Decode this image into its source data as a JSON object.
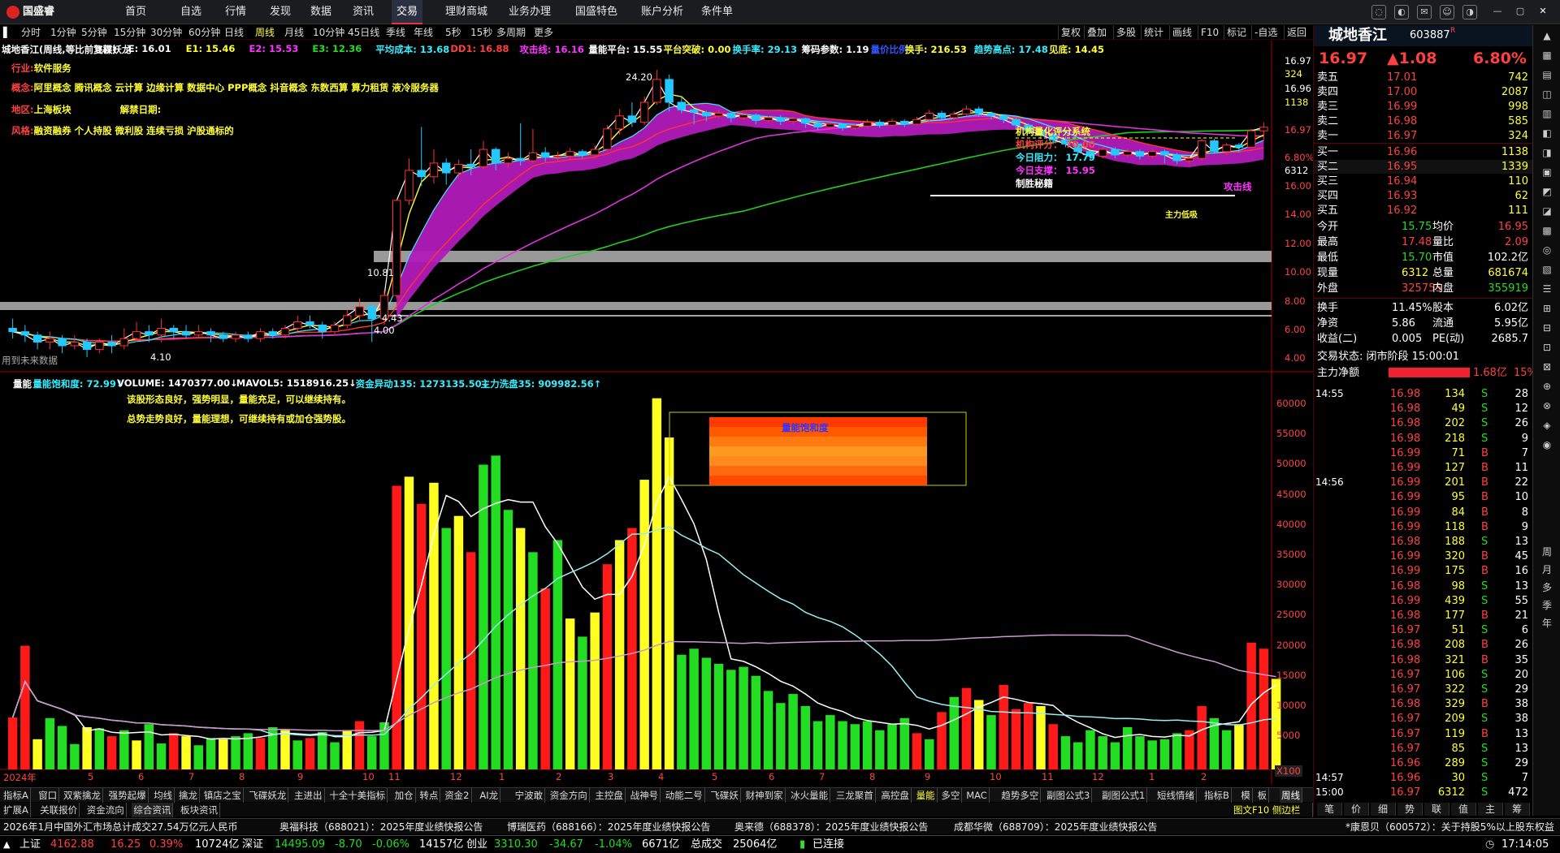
{
  "menu": {
    "brand": "国盛睿",
    "items": [
      "首页",
      "自选",
      "行情",
      "发现",
      "数据",
      "资讯",
      "交易",
      "理财商城",
      "业务办理",
      "国盛特色",
      "账户分析",
      "条件单"
    ],
    "active": "交易"
  },
  "periods": {
    "items": [
      "分时",
      "1分钟",
      "5分钟",
      "15分钟",
      "30分钟",
      "60分钟",
      "日线",
      "周线",
      "月线",
      "10分钟",
      "45日线",
      "季线",
      "年线",
      "5秒",
      "15秒",
      "多周期",
      "更多"
    ],
    "active": "周线"
  },
  "rightbtns": [
    "复权",
    "叠加",
    "多股",
    "统计",
    "画线",
    "F10",
    "标记",
    "-自选",
    "返回"
  ],
  "ma_line": [
    {
      "t": "城地香江(周线,等比前复权)",
      "c": "#ffffff"
    },
    {
      "t": "飞碟妖龙",
      "c": "#ffffff"
    },
    {
      "t": "E: 16.01",
      "c": "#ffffff"
    },
    {
      "t": "E1: 15.46",
      "c": "#ffff33"
    },
    {
      "t": "E2: 15.53",
      "c": "#ff33ff"
    },
    {
      "t": "E3: 12.36",
      "c": "#22dd22"
    },
    {
      "t": "平均成本: 13.68",
      "c": "#33eeff"
    },
    {
      "t": "DD1: 16.88",
      "c": "#ff4040"
    },
    {
      "t": "攻击线: 16.16",
      "c": "#ff33ff"
    },
    {
      "t": "量能平台: 15.55",
      "c": "#ffffff"
    },
    {
      "t": "平台突破: 0.00",
      "c": "#ffff33"
    },
    {
      "t": "换手率: 29.13",
      "c": "#33eeff"
    },
    {
      "t": "筹码参数: 1.19",
      "c": "#ffffff"
    },
    {
      "t": "量价比例",
      "c": "#3355ff"
    },
    {
      "t": "换手: 216.53",
      "c": "#ffff33"
    },
    {
      "t": "趋势高点: 17.48",
      "c": "#33eeff"
    },
    {
      "t": "见底: 14.45",
      "c": "#ffff33"
    }
  ],
  "info": {
    "industry_label": "行业:",
    "industry": "软件服务",
    "concept_label": "概念:",
    "concept": "阿里概念 腾讯概念 云计算 边缘计算 数据中心 PPP概念 抖音概念 东数西算 算力租赁 液冷服务器",
    "region_label": "地区:",
    "region": "上海板块",
    "unban_label": "解禁日期:",
    "style_label": "风格:",
    "style": "融资融券 个人持股 微利股 连续亏损 沪股通标的"
  },
  "annotations": {
    "high_price": "24.20",
    "low_price": "4.10",
    "mid1": "10.81",
    "mid2": "4.43",
    "mid3": "4.00",
    "attack_line": "攻击线",
    "main_force": "主力低吸",
    "scoring": {
      "title": "机构量化评分系统",
      "score": "机构评分： 70.00",
      "resist": "今日阻力： 17.79",
      "support": "今日支撑： 15.95",
      "tag": "制胜秘籍"
    },
    "future_data": "用到未来数据",
    "dragon": "龙",
    "buy": "B",
    "sell": "S"
  },
  "price_axis": [
    "16.97",
    "324",
    "16.96",
    "1138",
    "16.97",
    "6.80%",
    "6312",
    "16.00",
    "14.00",
    "12.00",
    "10.00",
    "8.00",
    "6.00",
    "4.00"
  ],
  "vol_header": [
    {
      "t": "量能",
      "c": "#ffffff"
    },
    {
      "t": "量能饱和度: 72.99↓",
      "c": "#33eeff"
    },
    {
      "t": "VOLUME: 1470377.00↓",
      "c": "#ffffff"
    },
    {
      "t": "MAVOL5: 1518916.25↓",
      "c": "#ffffff"
    },
    {
      "t": "资金异动135: 1273135.50↓",
      "c": "#33eeff"
    },
    {
      "t": "主力洗盘35: 909982.56↑",
      "c": "#33eeff"
    }
  ],
  "vol_comment1": "该股形态良好，强势明显，量能充足，可以继续持有。",
  "vol_comment2": "总势走势良好，量能理想，可继续持有或加仓强势股。",
  "saturation_title": "量能饱和度",
  "vol_axis": [
    "60000",
    "55000",
    "50000",
    "45000",
    "40000",
    "35000",
    "30000",
    "25000",
    "20000",
    "15000",
    "10000",
    "5000"
  ],
  "vol_unit": "X100",
  "x_axis": [
    "2024年",
    "5",
    "6",
    "7",
    "8",
    "9",
    "10",
    "11",
    "12",
    "1",
    "2",
    "3",
    "4",
    "5",
    "6",
    "7",
    "8",
    "9",
    "10",
    "11",
    "12",
    "1",
    "2"
  ],
  "chart_data": {
    "type": "candlestick",
    "title": "城地香江(周线,等比前复权)",
    "ylim": [
      4.0,
      24.2
    ],
    "weeks": [
      [
        4.9,
        4.8,
        5.2,
        4.6
      ],
      [
        4.8,
        4.7,
        5.0,
        4.5
      ],
      [
        4.7,
        4.5,
        4.8,
        4.3
      ],
      [
        4.5,
        4.6,
        4.8,
        4.3
      ],
      [
        4.6,
        4.4,
        4.7,
        4.2
      ],
      [
        4.4,
        4.5,
        4.7,
        4.3
      ],
      [
        4.5,
        4.3,
        4.6,
        4.1
      ],
      [
        4.3,
        4.5,
        4.6,
        4.2
      ],
      [
        4.5,
        4.4,
        4.7,
        4.2
      ],
      [
        4.4,
        4.6,
        4.9,
        4.3
      ],
      [
        4.6,
        4.8,
        5.1,
        4.5
      ],
      [
        4.8,
        4.7,
        5.0,
        4.5
      ],
      [
        4.7,
        4.9,
        5.2,
        4.5
      ],
      [
        4.9,
        4.8,
        5.0,
        4.6
      ],
      [
        4.8,
        4.7,
        5.0,
        4.6
      ],
      [
        4.7,
        4.8,
        5.0,
        4.6
      ],
      [
        4.8,
        4.7,
        4.9,
        4.5
      ],
      [
        4.7,
        4.6,
        4.8,
        4.5
      ],
      [
        4.6,
        4.7,
        4.8,
        4.5
      ],
      [
        4.7,
        4.6,
        4.8,
        4.5
      ],
      [
        4.6,
        4.8,
        4.9,
        4.5
      ],
      [
        4.8,
        4.7,
        4.9,
        4.6
      ],
      [
        4.7,
        4.9,
        5.0,
        4.6
      ],
      [
        4.9,
        5.1,
        5.3,
        4.8
      ],
      [
        5.1,
        5.0,
        5.3,
        4.9
      ],
      [
        5.0,
        4.8,
        5.1,
        4.6
      ],
      [
        4.8,
        5.0,
        5.1,
        4.7
      ],
      [
        5.0,
        5.3,
        5.5,
        4.9
      ],
      [
        5.3,
        5.6,
        5.9,
        5.1
      ],
      [
        5.6,
        5.2,
        5.7,
        4.5
      ],
      [
        5.2,
        6.0,
        6.2,
        5.0
      ],
      [
        6.0,
        10.8,
        10.9,
        5.9
      ],
      [
        10.8,
        13.0,
        14.0,
        10.5
      ],
      [
        13.0,
        12.5,
        17.0,
        11.8
      ],
      [
        12.5,
        13.6,
        14.8,
        12.0
      ],
      [
        13.6,
        12.8,
        14.0,
        11.9
      ],
      [
        12.8,
        13.5,
        13.9,
        12.4
      ],
      [
        13.5,
        13.3,
        14.8,
        12.6
      ],
      [
        13.3,
        14.8,
        15.6,
        13.1
      ],
      [
        14.8,
        13.6,
        15.0,
        13.0
      ],
      [
        13.6,
        14.0,
        14.5,
        13.2
      ],
      [
        14.0,
        13.8,
        17.4,
        13.4
      ],
      [
        13.8,
        14.5,
        16.8,
        13.6
      ],
      [
        14.5,
        14.1,
        15.0,
        13.7
      ],
      [
        14.1,
        14.2,
        14.6,
        13.8
      ],
      [
        14.2,
        14.6,
        14.9,
        13.9
      ],
      [
        14.6,
        14.3,
        14.8,
        14.0
      ],
      [
        14.3,
        14.8,
        15.2,
        14.0
      ],
      [
        14.8,
        16.8,
        17.2,
        14.6
      ],
      [
        16.8,
        18.2,
        19.0,
        16.2
      ],
      [
        18.2,
        17.5,
        19.8,
        17.0
      ],
      [
        17.5,
        19.8,
        20.5,
        17.2
      ],
      [
        19.8,
        22.8,
        24.2,
        19.5
      ],
      [
        22.8,
        19.8,
        23.5,
        18.7
      ],
      [
        19.8,
        18.9,
        20.5,
        18.5
      ],
      [
        18.9,
        18.6,
        19.0,
        17.3
      ],
      [
        18.6,
        18.2,
        18.8,
        17.6
      ],
      [
        18.2,
        18.5,
        18.9,
        17.9
      ],
      [
        18.5,
        18.0,
        18.7,
        17.5
      ],
      [
        18.0,
        18.3,
        18.6,
        17.7
      ],
      [
        18.3,
        17.7,
        18.5,
        17.3
      ],
      [
        17.7,
        18.0,
        18.2,
        17.4
      ],
      [
        18.0,
        17.6,
        18.3,
        17.2
      ],
      [
        17.6,
        17.9,
        18.1,
        17.3
      ],
      [
        17.9,
        17.4,
        18.0,
        16.9
      ],
      [
        17.4,
        17.0,
        17.6,
        16.7
      ],
      [
        17.0,
        17.3,
        17.5,
        16.8
      ],
      [
        17.3,
        16.9,
        17.4,
        16.6
      ],
      [
        16.9,
        17.1,
        17.3,
        16.7
      ],
      [
        17.1,
        17.5,
        17.8,
        16.9
      ],
      [
        17.5,
        17.2,
        17.8,
        16.9
      ],
      [
        17.2,
        17.6,
        17.9,
        17.0
      ],
      [
        17.6,
        17.3,
        17.8,
        17.0
      ],
      [
        17.3,
        17.8,
        18.1,
        17.1
      ],
      [
        17.8,
        18.5,
        18.9,
        17.5
      ],
      [
        18.5,
        18.0,
        18.8,
        17.7
      ],
      [
        18.0,
        18.4,
        18.7,
        17.8
      ],
      [
        18.4,
        19.0,
        19.4,
        18.2
      ],
      [
        19.0,
        18.5,
        19.3,
        18.1
      ],
      [
        18.5,
        18.2,
        18.7,
        17.8
      ],
      [
        18.2,
        17.8,
        18.4,
        17.4
      ],
      [
        17.8,
        17.2,
        18.0,
        16.8
      ],
      [
        17.2,
        16.6,
        17.4,
        16.3
      ],
      [
        16.6,
        16.2,
        16.8,
        15.8
      ],
      [
        16.2,
        15.7,
        16.4,
        15.3
      ],
      [
        15.7,
        15.3,
        16.0,
        15.0
      ],
      [
        15.3,
        14.6,
        15.5,
        14.3
      ],
      [
        14.6,
        14.2,
        14.8,
        13.9
      ],
      [
        14.2,
        14.8,
        15.0,
        14.0
      ],
      [
        14.8,
        14.3,
        15.0,
        14.0
      ],
      [
        14.3,
        14.6,
        14.9,
        14.1
      ],
      [
        14.6,
        14.2,
        14.8,
        13.9
      ],
      [
        14.2,
        14.6,
        14.9,
        14.0
      ],
      [
        14.6,
        14.3,
        14.8,
        13.6
      ],
      [
        14.3,
        13.8,
        14.5,
        13.5
      ],
      [
        13.8,
        14.0,
        14.2,
        13.5
      ],
      [
        14.0,
        15.6,
        15.8,
        13.8
      ],
      [
        15.6,
        14.6,
        15.8,
        14.4
      ],
      [
        14.6,
        15.2,
        15.4,
        14.3
      ],
      [
        15.2,
        15.0,
        15.4,
        14.5
      ],
      [
        15.0,
        16.6,
        16.8,
        14.9
      ],
      [
        16.6,
        16.97,
        17.48,
        15.7
      ]
    ],
    "volume_hundreds": [
      8600,
      20500,
      5000,
      8500,
      7200,
      4200,
      7000,
      6800,
      5500,
      6500,
      4800,
      7500,
      4300,
      6000,
      5500,
      4000,
      5200,
      5000,
      5500,
      6000,
      5200,
      7000,
      6500,
      4800,
      5200,
      6200,
      4500,
      6500,
      8000,
      5500,
      7800,
      47000,
      48500,
      44000,
      47500,
      40000,
      42000,
      36000,
      50500,
      52000,
      43000,
      40000,
      36000,
      30000,
      38000,
      25000,
      22000,
      26000,
      34000,
      38000,
      40000,
      48000,
      61500,
      55000,
      19000,
      20000,
      18500,
      17500,
      16500,
      17000,
      15500,
      13000,
      11000,
      12500,
      10500,
      8000,
      9000,
      8000,
      7500,
      8000,
      6500,
      7500,
      8500,
      6000,
      5000,
      9500,
      12000,
      13500,
      11500,
      9000,
      14000,
      10000,
      11000,
      10500,
      7500,
      5500,
      4500,
      6500,
      5500,
      4500,
      7000,
      5500,
      4800,
      5000,
      6000,
      6500,
      10500,
      8500,
      6500,
      7500,
      21000,
      20000,
      15000
    ],
    "volume_colors": [
      "r",
      "r",
      "y",
      "g",
      "g",
      "g",
      "y",
      "g",
      "r",
      "g",
      "y",
      "g",
      "g",
      "r",
      "y",
      "g",
      "g",
      "y",
      "g",
      "g",
      "r",
      "g",
      "y",
      "g",
      "r",
      "g",
      "g",
      "y",
      "r",
      "g",
      "g",
      "r",
      "y",
      "r",
      "y",
      "g",
      "y",
      "r",
      "g",
      "g",
      "g",
      "y",
      "g",
      "r",
      "g",
      "y",
      "g",
      "y",
      "r",
      "y",
      "r",
      "y",
      "y",
      "y",
      "g",
      "g",
      "g",
      "g",
      "g",
      "g",
      "g",
      "g",
      "g",
      "g",
      "g",
      "g",
      "g",
      "g",
      "g",
      "g",
      "g",
      "g",
      "g",
      "r",
      "g",
      "r",
      "g",
      "r",
      "y",
      "g",
      "r",
      "r",
      "r",
      "y",
      "r",
      "g",
      "g",
      "g",
      "g",
      "g",
      "g",
      "g",
      "g",
      "g",
      "g",
      "r",
      "r",
      "g",
      "g",
      "y",
      "r",
      "r",
      "y"
    ]
  },
  "quote": {
    "name": "城地香江",
    "code": "603887",
    "rflag": "R",
    "price": "16.97",
    "change": "▲1.08",
    "pct": "6.80%",
    "asks": [
      {
        "l": "卖五",
        "p": "17.01",
        "v": "742"
      },
      {
        "l": "卖四",
        "p": "17.00",
        "v": "2087"
      },
      {
        "l": "卖三",
        "p": "16.99",
        "v": "998"
      },
      {
        "l": "卖二",
        "p": "16.98",
        "v": "585"
      },
      {
        "l": "卖一",
        "p": "16.97",
        "v": "324"
      }
    ],
    "bids": [
      {
        "l": "买一",
        "p": "16.96",
        "v": "1138"
      },
      {
        "l": "买二",
        "p": "16.95",
        "v": "1339"
      },
      {
        "l": "买三",
        "p": "16.94",
        "v": "110"
      },
      {
        "l": "买四",
        "p": "16.93",
        "v": "62"
      },
      {
        "l": "买五",
        "p": "16.92",
        "v": "111"
      }
    ],
    "stats": [
      {
        "a": "今开",
        "av": "15.75",
        "ac": "#22dd22",
        "b": "均价",
        "bv": "16.95",
        "bc": "#ff4040"
      },
      {
        "a": "最高",
        "av": "17.48",
        "ac": "#ff4040",
        "b": "量比",
        "bv": "2.09",
        "bc": "#ff4040"
      },
      {
        "a": "最低",
        "av": "15.70",
        "ac": "#22dd22",
        "b": "市值",
        "bv": "102.2亿",
        "bc": "#ffffff"
      },
      {
        "a": "现量",
        "av": "6312",
        "ac": "#ffff33",
        "b": "总量",
        "bv": "681674",
        "bc": "#ffff33"
      },
      {
        "a": "外盘",
        "av": "325755",
        "ac": "#ff4040",
        "b": "内盘",
        "bv": "355919",
        "bc": "#22dd22"
      }
    ],
    "stats2": [
      {
        "a": "换手",
        "av": "11.45%",
        "b": "股本",
        "bv": "6.02亿"
      },
      {
        "a": "净资",
        "av": "5.86",
        "b": "流通",
        "bv": "5.95亿"
      },
      {
        "a": "收益(二)",
        "av": "0.005",
        "b": "PE(动)",
        "bv": "2685.7"
      }
    ],
    "trade_status": "交易状态: 闭市阶段 15:00:01",
    "net_label": "主力净额",
    "net_value": "1.68亿",
    "net_pct": "15%",
    "ticks_time1": "14:55",
    "ticks_time2": "14:56",
    "ticks_time3": "14:57",
    "ticks_time4": "15:00",
    "ticks": [
      [
        "16.98",
        "134",
        "S",
        "28"
      ],
      [
        "16.98",
        "49",
        "S",
        "12"
      ],
      [
        "16.98",
        "202",
        "S",
        "26"
      ],
      [
        "16.98",
        "218",
        "S",
        "9"
      ],
      [
        "16.99",
        "71",
        "B",
        "7"
      ],
      [
        "16.99",
        "127",
        "B",
        "11"
      ],
      [
        "16.99",
        "201",
        "B",
        "22"
      ],
      [
        "16.99",
        "95",
        "B",
        "10"
      ],
      [
        "16.99",
        "84",
        "B",
        "8"
      ],
      [
        "16.99",
        "118",
        "B",
        "9"
      ],
      [
        "16.98",
        "188",
        "S",
        "13"
      ],
      [
        "16.99",
        "320",
        "B",
        "45"
      ],
      [
        "16.99",
        "175",
        "B",
        "16"
      ],
      [
        "16.98",
        "98",
        "S",
        "13"
      ],
      [
        "16.99",
        "439",
        "S",
        "55"
      ],
      [
        "16.98",
        "177",
        "B",
        "21"
      ],
      [
        "16.97",
        "51",
        "S",
        "6"
      ],
      [
        "16.98",
        "208",
        "B",
        "26"
      ],
      [
        "16.98",
        "321",
        "B",
        "35"
      ],
      [
        "16.97",
        "106",
        "S",
        "20"
      ],
      [
        "16.97",
        "322",
        "S",
        "29"
      ],
      [
        "16.98",
        "329",
        "B",
        "38"
      ],
      [
        "16.97",
        "209",
        "S",
        "38"
      ],
      [
        "16.97",
        "119",
        "B",
        "13"
      ],
      [
        "16.97",
        "85",
        "S",
        "13"
      ],
      [
        "16.96",
        "289",
        "S",
        "29"
      ],
      [
        "16.96",
        "30",
        "S",
        "7"
      ],
      [
        "16.97",
        "6312",
        "S",
        "472"
      ]
    ],
    "bottom_tabs": [
      "笔",
      "价",
      "细",
      "势",
      "联",
      "值",
      "主",
      "筹"
    ]
  },
  "sidetools": [
    "周",
    "月",
    "多",
    "季",
    "年"
  ],
  "tabs1": [
    "指标A",
    "窗口",
    "双紫擒龙",
    "强势起爆",
    "均线",
    "擒龙",
    "镇店之宝",
    "飞碟妖龙",
    "主进出",
    "十全十美指标",
    "加仓",
    "转点",
    "资金2",
    "AI龙",
    "宁波敢",
    "资金方向",
    "主控盘",
    "战神号",
    "动能二号",
    "飞碟妖",
    "财神到家",
    "冰火量能",
    "三龙聚首",
    "高控盘",
    "量能",
    "多空",
    "MAC",
    "趋势多空",
    "副图公式3",
    "副图公式1",
    "短线情绪"
  ],
  "tabs1_active": "量能",
  "tabs1_right": [
    "指标B",
    "模",
    "板"
  ],
  "tabs2": [
    "扩展A",
    "关联报价",
    "资金流向",
    "综合资讯",
    "板块资讯"
  ],
  "tabs2_right": "图文F10 侧边栏 ≪",
  "news": [
    "2026年1月中国外汇市场总计成交27.54万亿元人民币",
    "奥福科技（688021）：2025年度业绩快报公告",
    "博瑞医药（688166）：2025年度业绩快报公告",
    "奥来德（688378）：2025年度业绩快报公告",
    "成都华微（688709）：2025年度业绩快报公告",
    "*康恩贝（600572）：关于持股5%以上股东权益"
  ],
  "status": {
    "sh_label": "上证",
    "sh": "4162.88",
    "sh_ch": "16.25",
    "sh_pct": "0.39%",
    "sh_amt": "10724亿",
    "sz_label": "深证",
    "sz": "14495.09",
    "sz_ch": "-8.70",
    "sz_pct": "-0.06%",
    "sz_amt": "14157亿",
    "cy_label": "创业",
    "cy": "3310.30",
    "cy_ch": "-34.67",
    "cy_pct": "-1.04%",
    "cy_amt": "6671亿",
    "total_label": "总成交",
    "total": "25064亿",
    "conn": "已连接",
    "time": "17:14:05"
  }
}
